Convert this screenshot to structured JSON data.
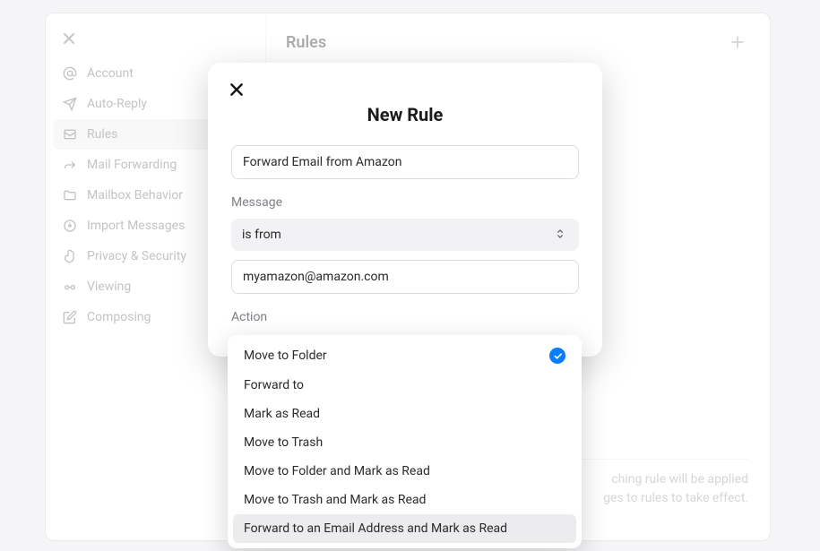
{
  "sidebar": {
    "items": [
      {
        "label": "Account"
      },
      {
        "label": "Auto-Reply"
      },
      {
        "label": "Rules"
      },
      {
        "label": "Mail Forwarding"
      },
      {
        "label": "Mailbox Behavior"
      },
      {
        "label": "Import Messages"
      },
      {
        "label": "Privacy & Security"
      },
      {
        "label": "Viewing"
      },
      {
        "label": "Composing"
      }
    ]
  },
  "content": {
    "title": "Rules",
    "hint_line1": "ching rule will be applied",
    "hint_line2": "ges to rules to take effect."
  },
  "modal": {
    "title": "New Rule",
    "name_value": "Forward Email from Amazon",
    "label_message": "Message",
    "condition_select": "is from",
    "condition_value": "myamazon@amazon.com",
    "label_action": "Action"
  },
  "dropdown": {
    "options": [
      "Move to Folder",
      "Forward to",
      "Mark as Read",
      "Move to Trash",
      "Move to Folder and Mark as Read",
      "Move to Trash and Mark as Read",
      "Forward to an Email Address and Mark as Read"
    ],
    "selected_index": 0,
    "hover_index": 6
  }
}
